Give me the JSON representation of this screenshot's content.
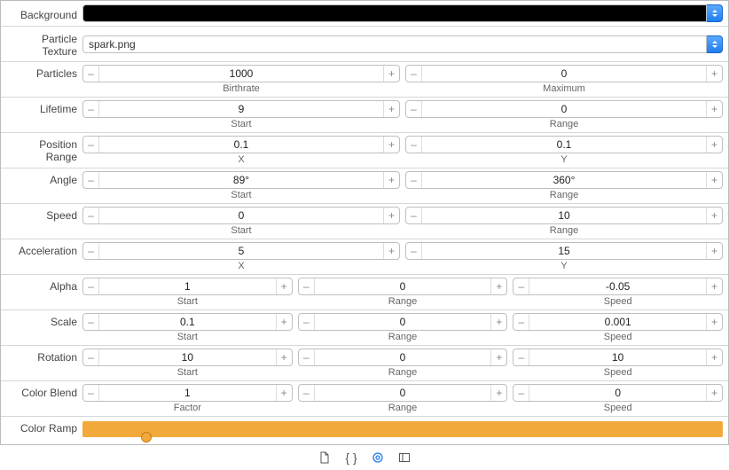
{
  "labels": {
    "background": "Background",
    "particleTexture": "Particle Texture",
    "particles": "Particles",
    "lifetime": "Lifetime",
    "positionRange": "Position Range",
    "angle": "Angle",
    "speed": "Speed",
    "acceleration": "Acceleration",
    "alpha": "Alpha",
    "scale": "Scale",
    "rotation": "Rotation",
    "colorBlend": "Color Blend",
    "colorRamp": "Color Ramp"
  },
  "sub": {
    "birthrate": "Birthrate",
    "maximum": "Maximum",
    "start": "Start",
    "range": "Range",
    "x": "X",
    "y": "Y",
    "speed": "Speed",
    "factor": "Factor"
  },
  "texture": "spark.png",
  "particles": {
    "birthrate": "1000",
    "maximum": "0"
  },
  "lifetime": {
    "start": "9",
    "range": "0"
  },
  "positionRange": {
    "x": "0.1",
    "y": "0.1"
  },
  "angle": {
    "start": "89°",
    "range": "360°"
  },
  "speed": {
    "start": "0",
    "range": "10"
  },
  "acceleration": {
    "x": "5",
    "y": "15"
  },
  "alpha": {
    "start": "1",
    "range": "0",
    "speed": "-0.05"
  },
  "scale": {
    "start": "0.1",
    "range": "0",
    "speed": "0.001"
  },
  "rotation": {
    "start": "10",
    "range": "0",
    "speed": "10"
  },
  "colorBlend": {
    "factor": "1",
    "range": "0",
    "speed": "0"
  },
  "glyph": {
    "minus": "–",
    "plus": "+"
  }
}
